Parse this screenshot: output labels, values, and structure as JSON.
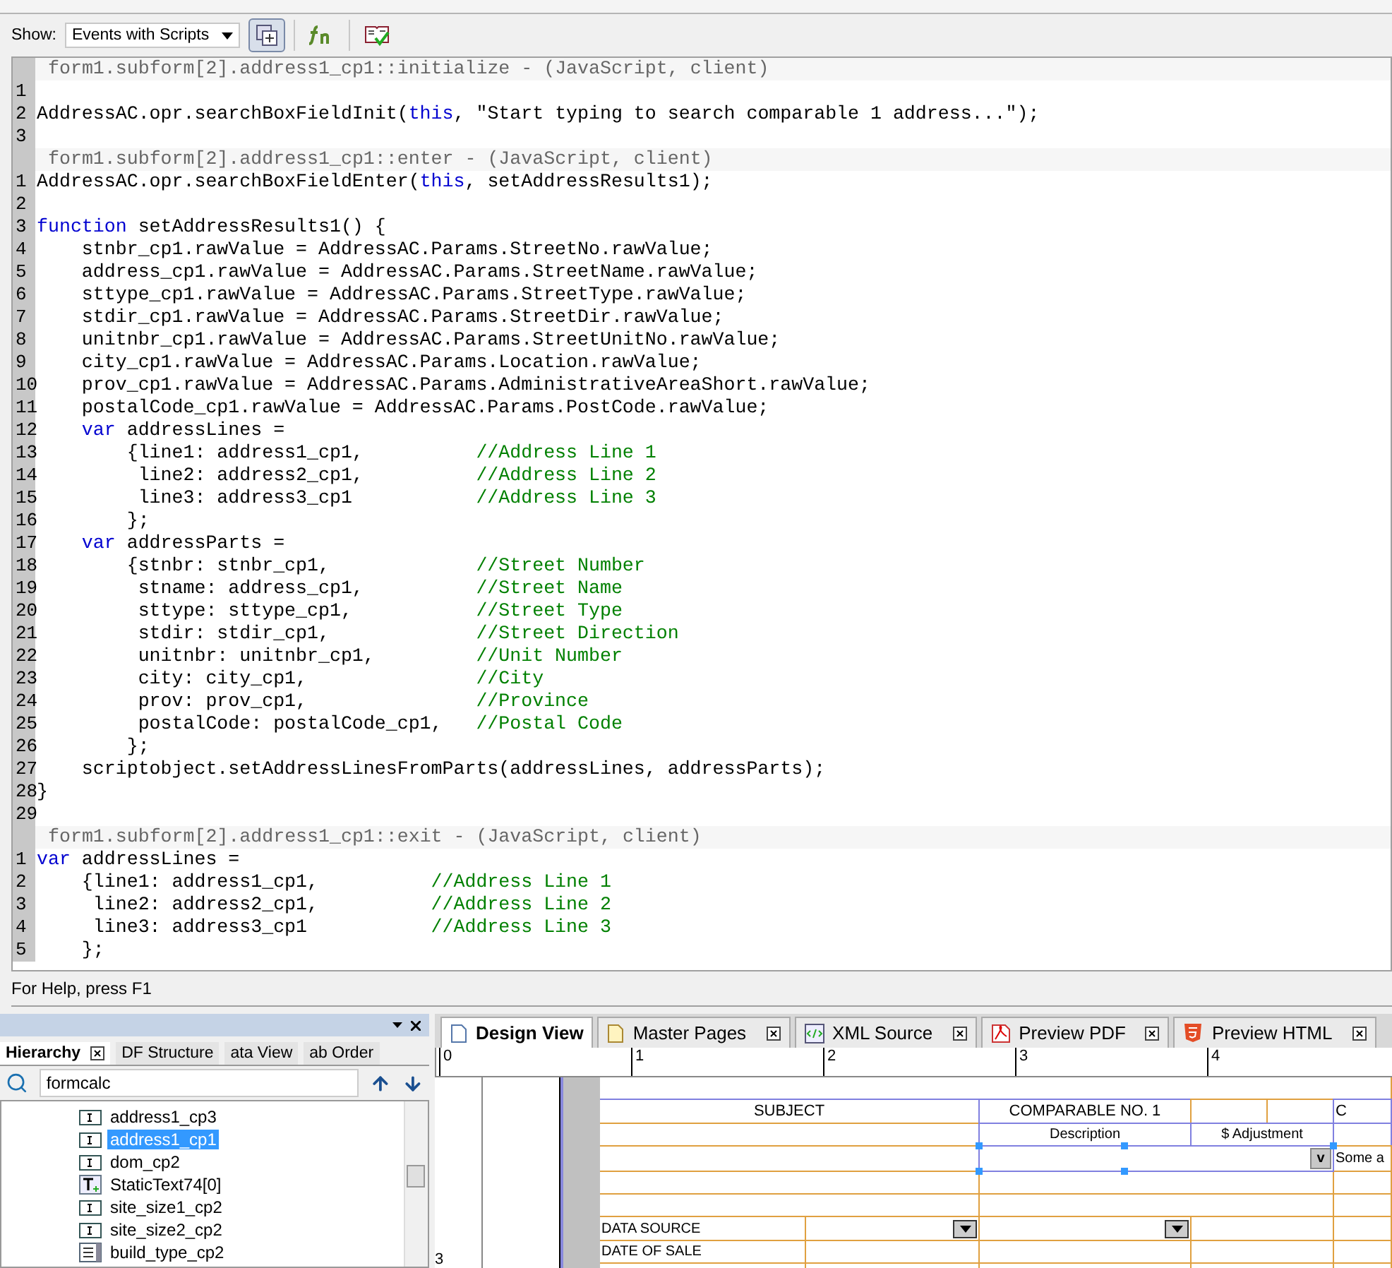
{
  "toolbar": {
    "show_label": "Show:",
    "show_value": "Events with Scripts",
    "buttons": [
      {
        "kind": "insert",
        "on": true
      },
      {
        "kind": "function",
        "on": false
      },
      {
        "kind": "check",
        "on": false
      }
    ]
  },
  "script_blocks": [
    {
      "header": "form1.subform[2].address1_cp1::initialize - (JavaScript, client)",
      "lines": [
        {
          "num": "1"
        },
        {
          "num": "2",
          "segs": [
            {
              "kind": "code",
              "text": "AddressAC.opr.searchBoxFieldInit("
            },
            {
              "kind": "keyword",
              "text": "this"
            },
            {
              "kind": "code",
              "text": ", \"Start typing to search comparable 1 address...\");"
            }
          ]
        },
        {
          "num": "3"
        }
      ]
    },
    {
      "header": "form1.subform[2].address1_cp1::enter - (JavaScript, client)",
      "lines": [
        {
          "num": "1",
          "segs": [
            {
              "kind": "code",
              "text": "AddressAC.opr.searchBoxFieldEnter("
            },
            {
              "kind": "keyword",
              "text": "this"
            },
            {
              "kind": "code",
              "text": ", setAddressResults1);"
            }
          ]
        },
        {
          "num": "2"
        },
        {
          "num": "3",
          "segs": [
            {
              "kind": "keyword",
              "text": "function"
            },
            {
              "kind": "code",
              "text": " setAddressResults1() {"
            }
          ]
        },
        {
          "num": "4",
          "segs": [
            {
              "kind": "code",
              "text": "    stnbr_cp1.rawValue = AddressAC.Params.StreetNo.rawValue;"
            }
          ]
        },
        {
          "num": "5",
          "segs": [
            {
              "kind": "code",
              "text": "    address_cp1.rawValue = AddressAC.Params.StreetName.rawValue;"
            }
          ]
        },
        {
          "num": "6",
          "segs": [
            {
              "kind": "code",
              "text": "    sttype_cp1.rawValue = AddressAC.Params.StreetType.rawValue;"
            }
          ]
        },
        {
          "num": "7",
          "segs": [
            {
              "kind": "code",
              "text": "    stdir_cp1.rawValue = AddressAC.Params.StreetDir.rawValue;"
            }
          ]
        },
        {
          "num": "8",
          "segs": [
            {
              "kind": "code",
              "text": "    unitnbr_cp1.rawValue = AddressAC.Params.StreetUnitNo.rawValue;"
            }
          ]
        },
        {
          "num": "9",
          "segs": [
            {
              "kind": "code",
              "text": "    city_cp1.rawValue = AddressAC.Params.Location.rawValue;"
            }
          ]
        },
        {
          "num": "10",
          "segs": [
            {
              "kind": "code",
              "text": "    prov_cp1.rawValue = AddressAC.Params.AdministrativeAreaShort.rawValue;"
            }
          ]
        },
        {
          "num": "11",
          "segs": [
            {
              "kind": "code",
              "text": "    postalCode_cp1.rawValue = AddressAC.Params.PostCode.rawValue;"
            }
          ]
        },
        {
          "num": "12",
          "segs": [
            {
              "kind": "keyword",
              "text": "    var"
            },
            {
              "kind": "code",
              "text": " addressLines ="
            }
          ]
        },
        {
          "num": "13",
          "segs": [
            {
              "kind": "code",
              "text": "        {line1: address1_cp1,          "
            },
            {
              "kind": "comment",
              "text": "//Address Line 1"
            }
          ]
        },
        {
          "num": "14",
          "segs": [
            {
              "kind": "code",
              "text": "         line2: address2_cp1,          "
            },
            {
              "kind": "comment",
              "text": "//Address Line 2"
            }
          ]
        },
        {
          "num": "15",
          "segs": [
            {
              "kind": "code",
              "text": "         line3: address3_cp1           "
            },
            {
              "kind": "comment",
              "text": "//Address Line 3"
            }
          ]
        },
        {
          "num": "16",
          "segs": [
            {
              "kind": "code",
              "text": "        };"
            }
          ]
        },
        {
          "num": "17",
          "segs": [
            {
              "kind": "keyword",
              "text": "    var"
            },
            {
              "kind": "code",
              "text": " addressParts ="
            }
          ]
        },
        {
          "num": "18",
          "segs": [
            {
              "kind": "code",
              "text": "        {stnbr: stnbr_cp1,             "
            },
            {
              "kind": "comment",
              "text": "//Street Number"
            }
          ]
        },
        {
          "num": "19",
          "segs": [
            {
              "kind": "code",
              "text": "         stname: address_cp1,          "
            },
            {
              "kind": "comment",
              "text": "//Street Name"
            }
          ]
        },
        {
          "num": "20",
          "segs": [
            {
              "kind": "code",
              "text": "         sttype: sttype_cp1,           "
            },
            {
              "kind": "comment",
              "text": "//Street Type"
            }
          ]
        },
        {
          "num": "21",
          "segs": [
            {
              "kind": "code",
              "text": "         stdir: stdir_cp1,             "
            },
            {
              "kind": "comment",
              "text": "//Street Direction"
            }
          ]
        },
        {
          "num": "22",
          "segs": [
            {
              "kind": "code",
              "text": "         unitnbr: unitnbr_cp1,         "
            },
            {
              "kind": "comment",
              "text": "//Unit Number"
            }
          ]
        },
        {
          "num": "23",
          "segs": [
            {
              "kind": "code",
              "text": "         city: city_cp1,               "
            },
            {
              "kind": "comment",
              "text": "//City"
            }
          ]
        },
        {
          "num": "24",
          "segs": [
            {
              "kind": "code",
              "text": "         prov: prov_cp1,               "
            },
            {
              "kind": "comment",
              "text": "//Province"
            }
          ]
        },
        {
          "num": "25",
          "segs": [
            {
              "kind": "code",
              "text": "         postalCode: postalCode_cp1,   "
            },
            {
              "kind": "comment",
              "text": "//Postal Code"
            }
          ]
        },
        {
          "num": "26",
          "segs": [
            {
              "kind": "code",
              "text": "        };"
            }
          ]
        },
        {
          "num": "27",
          "segs": [
            {
              "kind": "code",
              "text": "    scriptobject.setAddressLinesFromParts(addressLines, addressParts);"
            }
          ]
        },
        {
          "num": "28",
          "segs": [
            {
              "kind": "code",
              "text": "}"
            }
          ]
        },
        {
          "num": "29"
        }
      ]
    },
    {
      "header": "form1.subform[2].address1_cp1::exit - (JavaScript, client)",
      "lines": [
        {
          "num": "1",
          "segs": [
            {
              "kind": "keyword",
              "text": "var"
            },
            {
              "kind": "code",
              "text": " addressLines ="
            }
          ]
        },
        {
          "num": "2",
          "segs": [
            {
              "kind": "code",
              "text": "    {line1: address1_cp1,          "
            },
            {
              "kind": "comment",
              "text": "//Address Line 1"
            }
          ]
        },
        {
          "num": "3",
          "segs": [
            {
              "kind": "code",
              "text": "     line2: address2_cp1,          "
            },
            {
              "kind": "comment",
              "text": "//Address Line 2"
            }
          ]
        },
        {
          "num": "4",
          "segs": [
            {
              "kind": "code",
              "text": "     line3: address3_cp1           "
            },
            {
              "kind": "comment",
              "text": "//Address Line 3"
            }
          ]
        },
        {
          "num": "5",
          "segs": [
            {
              "kind": "code",
              "text": "    };"
            }
          ]
        }
      ]
    }
  ],
  "status_bar": "For Help, press F1",
  "hierarchy_panel": {
    "tabs": [
      {
        "label": "Hierarchy",
        "selected": true
      },
      {
        "label": "DF Structure",
        "selected": false
      },
      {
        "label": "ata View",
        "selected": false
      },
      {
        "label": "ab Order",
        "selected": false
      }
    ],
    "search": {
      "value": "formcalc"
    },
    "items": [
      {
        "label": "address1_cp3",
        "kind": "field",
        "selected": false
      },
      {
        "label": "address1_cp1",
        "kind": "field",
        "selected": true
      },
      {
        "label": "dom_cp2",
        "kind": "field",
        "selected": false
      },
      {
        "label": "StaticText74[0]",
        "kind": "text",
        "selected": false
      },
      {
        "label": "site_size1_cp2",
        "kind": "field",
        "selected": false
      },
      {
        "label": "site_size2_cp2",
        "kind": "field",
        "selected": false
      },
      {
        "label": "build_type_cp2",
        "kind": "list",
        "selected": false
      }
    ]
  },
  "design_panel": {
    "tabs": [
      {
        "label": "Design View",
        "kind": "page",
        "selected": true
      },
      {
        "label": "Master Pages",
        "kind": "master",
        "selected": false
      },
      {
        "label": "XML Source",
        "kind": "xml",
        "selected": false
      },
      {
        "label": "Preview PDF",
        "kind": "pdf",
        "selected": false
      },
      {
        "label": "Preview HTML",
        "kind": "html",
        "selected": false
      }
    ],
    "ruler": [
      "0",
      "1",
      "2",
      "3",
      "4"
    ],
    "side_ruler": "3",
    "form": {
      "headers": [
        "SUBJECT",
        "COMPARABLE NO. 1",
        "C"
      ],
      "subheaders": [
        "Description",
        "$ Adjustment"
      ],
      "field_button": "v",
      "field_text": "Some a",
      "rows": [
        {
          "label": "DATA SOURCE",
          "kind": "dropdown"
        },
        {
          "label": "DATE OF SALE",
          "kind": "plain"
        }
      ]
    }
  }
}
